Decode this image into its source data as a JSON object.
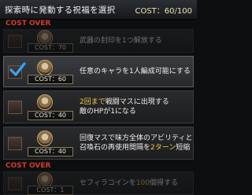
{
  "header": {
    "title": "探索時に発動する祝福を選択",
    "cost_label": "COST：",
    "cost_current": "60",
    "cost_separator": "/",
    "cost_max": "100"
  },
  "cost_over_label": "COST OVER",
  "blessings": [
    {
      "cost": "COST：70",
      "description": "武器の封印を1つ解放する",
      "state": "dimmed"
    },
    {
      "cost": "COST：60",
      "description": "任意のキャラを1人編成可能にする",
      "state": "selected"
    },
    {
      "cost": "COST：40",
      "line1_hl": "2回まで",
      "line1_rest": "戦闘マスに出現する",
      "line2": "敵のHPが1になる",
      "state": "normal"
    },
    {
      "cost": "COST：40",
      "line1": "回復マスで味方全体のアビリティと",
      "line2_pre": "召喚石の再使用間隔を",
      "line2_hl": "2ターン",
      "line2_post": "短縮",
      "state": "normal"
    },
    {
      "cost": "COST：1",
      "desc_pre": "セフィラコインを",
      "desc_hl": "100",
      "desc_post": "個得する",
      "state": "dimmed"
    }
  ],
  "colors": {
    "cost_over": "#d23b2b",
    "highlight": "#f2c94c",
    "check": "#2fa6ff"
  }
}
